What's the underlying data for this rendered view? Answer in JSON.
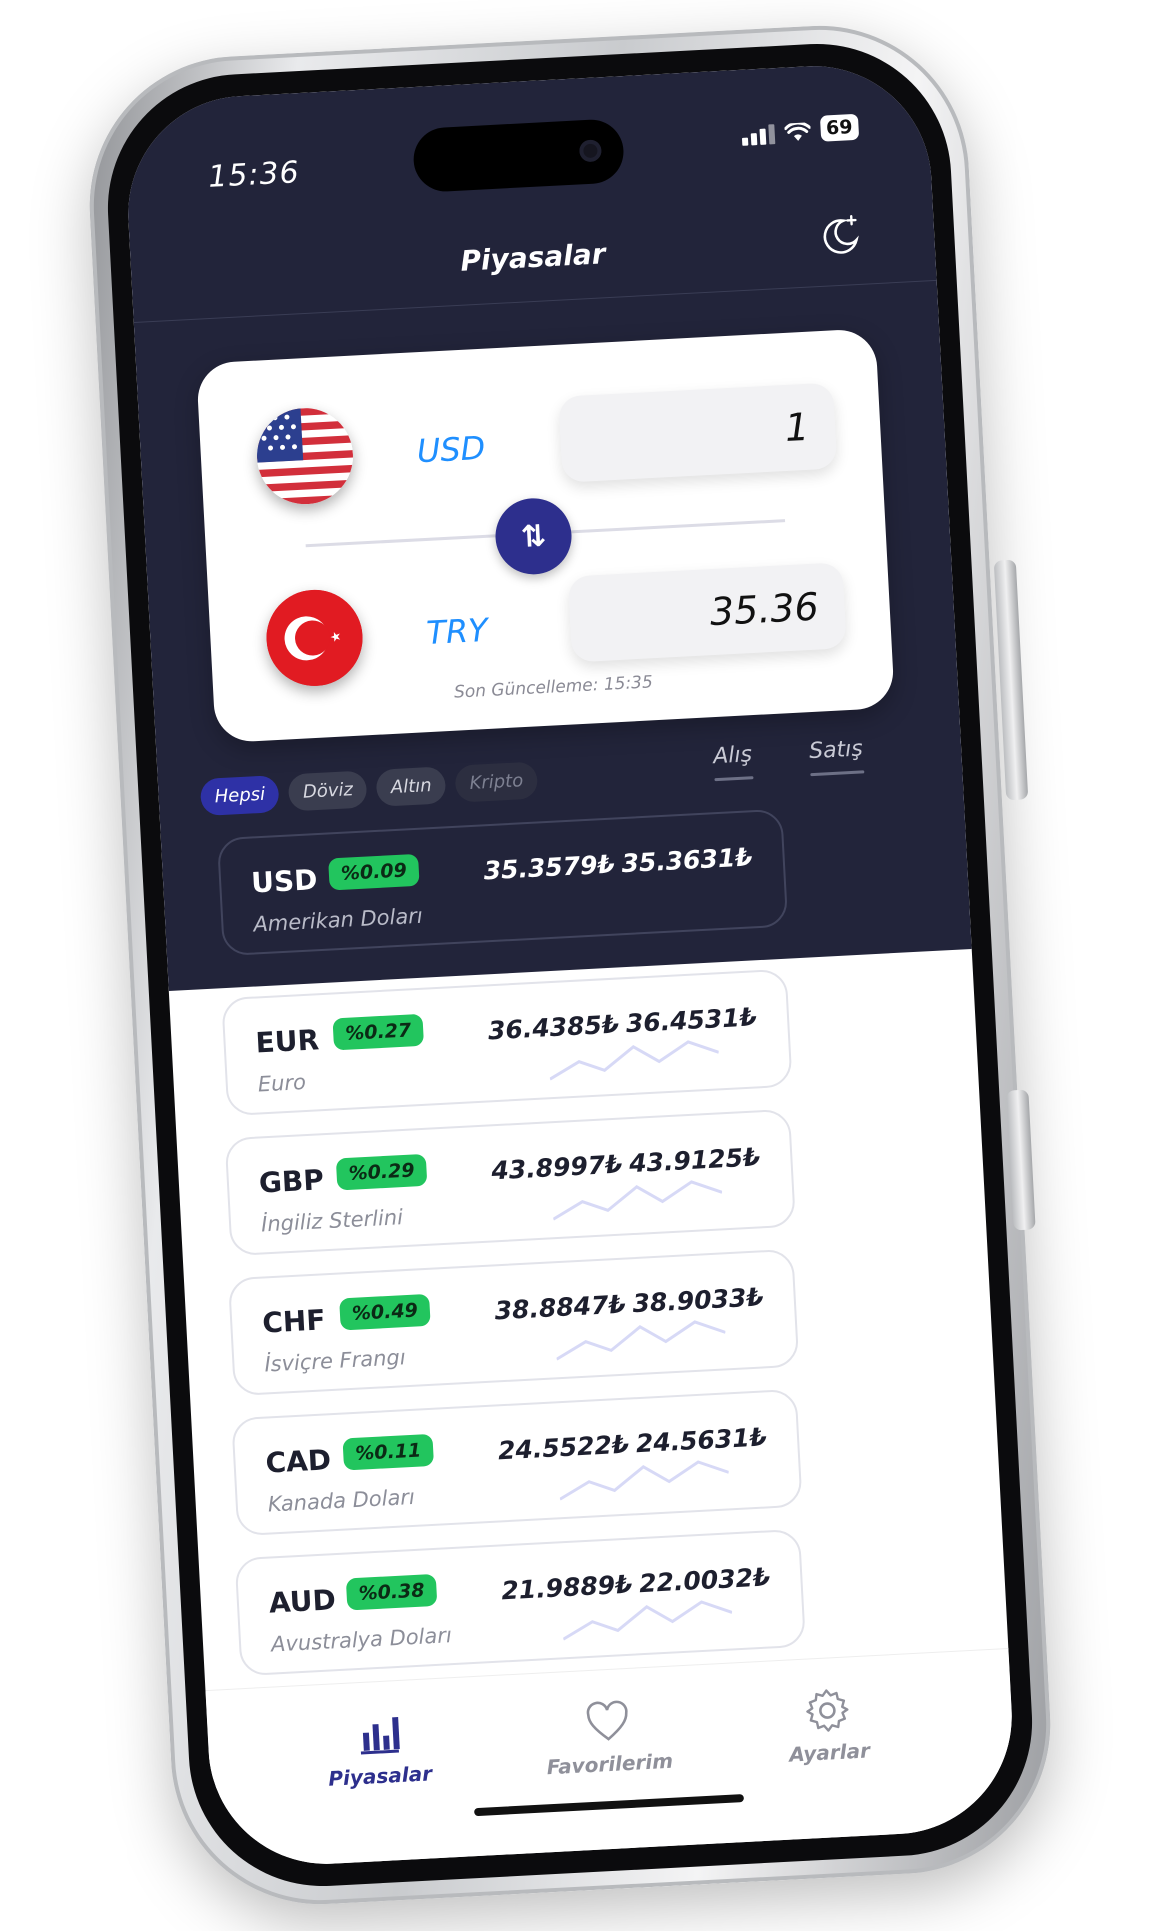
{
  "status_bar": {
    "time": "15:36",
    "battery": "69"
  },
  "header": {
    "title": "Piyasalar"
  },
  "converter": {
    "from_code": "USD",
    "from_amount": "1",
    "to_code": "TRY",
    "to_amount": "35.36",
    "last_update": "Son Güncelleme: 15:35"
  },
  "filters": {
    "tabs": [
      "Hepsi",
      "Döviz",
      "Altın",
      "Kripto"
    ],
    "active": "Hepsi"
  },
  "columns": {
    "buy": "Alış",
    "sell": "Satış"
  },
  "rates": [
    {
      "code": "USD",
      "change": "%0.09",
      "name": "Amerikan Doları",
      "buy": "35.3579₺",
      "sell": "35.3631₺"
    },
    {
      "code": "EUR",
      "change": "%0.27",
      "name": "Euro",
      "buy": "36.4385₺",
      "sell": "36.4531₺"
    },
    {
      "code": "GBP",
      "change": "%0.29",
      "name": "İngiliz Sterlini",
      "buy": "43.8997₺",
      "sell": "43.9125₺"
    },
    {
      "code": "CHF",
      "change": "%0.49",
      "name": "İsviçre Frangı",
      "buy": "38.8847₺",
      "sell": "38.9033₺"
    },
    {
      "code": "CAD",
      "change": "%0.11",
      "name": "Kanada Doları",
      "buy": "24.5522₺",
      "sell": "24.5631₺"
    },
    {
      "code": "AUD",
      "change": "%0.38",
      "name": "Avustralya Doları",
      "buy": "21.9889₺",
      "sell": "22.0032₺"
    }
  ],
  "bottom_nav": {
    "markets": "Piyasalar",
    "favorites": "Favorilerim",
    "settings": "Ayarlar"
  },
  "colors": {
    "dark_bg": "#22243a",
    "accent": "#2d2f8d",
    "positive_badge": "#22c55e",
    "currency_code_blue": "#1f8fff"
  },
  "icons": {
    "theme_toggle": "moon-icon",
    "swap": "swap-arrows-icon",
    "markets": "bar-chart-icon",
    "favorites": "heart-icon",
    "settings": "gear-icon"
  }
}
